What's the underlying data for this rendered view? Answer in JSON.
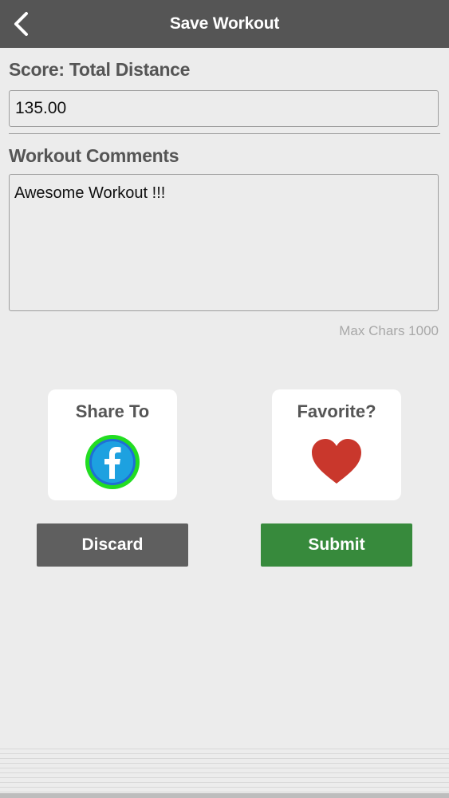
{
  "header": {
    "title": "Save Workout",
    "back_icon": "chevron-left-icon"
  },
  "score": {
    "label": "Score: Total Distance",
    "value": "135.00"
  },
  "comments": {
    "label": "Workout Comments",
    "value": "Awesome Workout !!!",
    "max_chars_note": "Max Chars 1000"
  },
  "share": {
    "title": "Share To",
    "icon": "facebook-icon"
  },
  "favorite": {
    "title": "Favorite?",
    "icon": "heart-icon"
  },
  "actions": {
    "discard_label": "Discard",
    "submit_label": "Submit"
  },
  "colors": {
    "header_bg": "#555555",
    "submit_green": "#378a3c",
    "discard_gray": "#5f5f5f",
    "heart_red": "#c9372c",
    "facebook_blue": "#1da1e0",
    "facebook_ring_green": "#22dd22"
  }
}
